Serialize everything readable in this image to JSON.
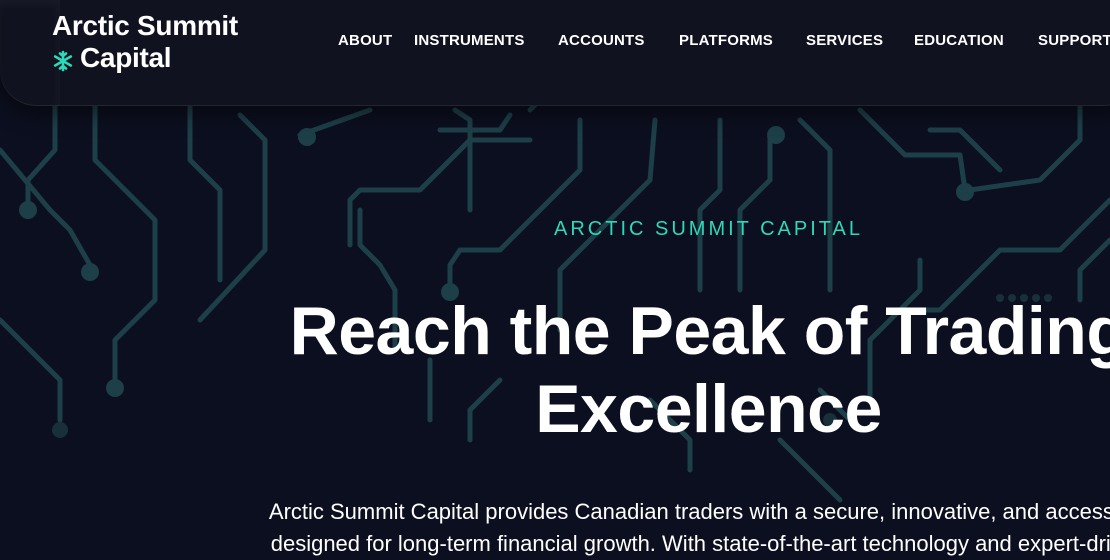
{
  "brand": {
    "name_line1": "Arctic Summit",
    "name_line2": "Capital",
    "icon": "snowflake-icon"
  },
  "nav": {
    "items": [
      {
        "label": "ABOUT"
      },
      {
        "label": "INSTRUMENTS"
      },
      {
        "label": "ACCOUNTS"
      },
      {
        "label": "PLATFORMS"
      },
      {
        "label": "SERVICES"
      },
      {
        "label": "EDUCATION"
      },
      {
        "label": "SUPPORT"
      }
    ]
  },
  "hero": {
    "eyebrow": "ARCTIC SUMMIT CAPITAL",
    "title_line1": "Reach the Peak of Trading",
    "title_line2": "Excellence",
    "description_line1": "Arctic Summit Capital provides Canadian traders with a secure, innovative, and accessible",
    "description_line2": "designed for long-term financial growth. With state-of-the-art technology and expert-driven"
  },
  "colors": {
    "background": "#0c0f1f",
    "header": "#10131f",
    "accent": "#2ed8b8",
    "circuit": "#1d3f48",
    "text": "#ffffff"
  }
}
